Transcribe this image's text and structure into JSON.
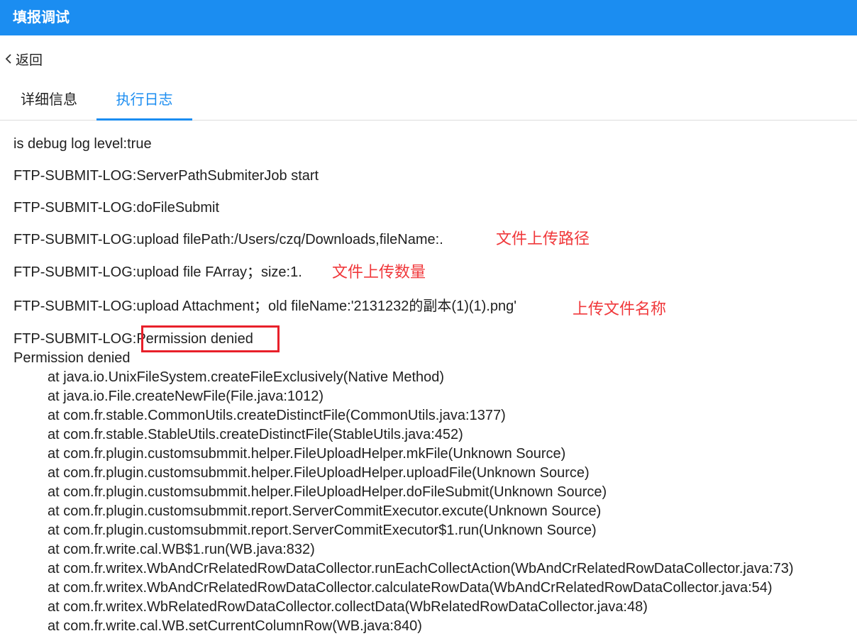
{
  "window": {
    "title": "填报调试"
  },
  "nav": {
    "back_label": "返回"
  },
  "tabs": [
    {
      "label": "详细信息",
      "active": false
    },
    {
      "label": "执行日志",
      "active": true
    }
  ],
  "log": {
    "lines": [
      "is debug log level:true",
      "FTP-SUBMIT-LOG:ServerPathSubmiterJob start",
      "FTP-SUBMIT-LOG:doFileSubmit",
      "FTP-SUBMIT-LOG:upload filePath:/Users/czq/Downloads,fileName:.",
      "FTP-SUBMIT-LOG:upload file FArray；size:1.",
      "FTP-SUBMIT-LOG:upload Attachment；old fileName:'2131232的副本(1)(1).png'",
      "FTP-SUBMIT-LOG:Permission denied"
    ],
    "error_message": "Permission denied",
    "stack_trace": [
      "at java.io.UnixFileSystem.createFileExclusively(Native Method)",
      "at java.io.File.createNewFile(File.java:1012)",
      "at com.fr.stable.CommonUtils.createDistinctFile(CommonUtils.java:1377)",
      "at com.fr.stable.StableUtils.createDistinctFile(StableUtils.java:452)",
      "at com.fr.plugin.customsubmmit.helper.FileUploadHelper.mkFile(Unknown Source)",
      "at com.fr.plugin.customsubmmit.helper.FileUploadHelper.uploadFile(Unknown Source)",
      "at com.fr.plugin.customsubmmit.helper.FileUploadHelper.doFileSubmit(Unknown Source)",
      "at com.fr.plugin.customsubmmit.report.ServerCommitExecutor.excute(Unknown Source)",
      "at com.fr.plugin.customsubmmit.report.ServerCommitExecutor$1.run(Unknown Source)",
      "at com.fr.write.cal.WB$1.run(WB.java:832)",
      "at com.fr.writex.WbAndCrRelatedRowDataCollector.runEachCollectAction(WbAndCrRelatedRowDataCollector.java:73)",
      "at com.fr.writex.WbAndCrRelatedRowDataCollector.calculateRowData(WbAndCrRelatedRowDataCollector.java:54)",
      "at com.fr.writex.WbRelatedRowDataCollector.collectData(WbRelatedRowDataCollector.java:48)",
      "at com.fr.write.cal.WB.setCurrentColumnRow(WB.java:840)"
    ]
  },
  "annotations": {
    "file_path": "文件上传路径",
    "file_count": "文件上传数量",
    "file_name": "上传文件名称"
  },
  "colors": {
    "title_bar": "#1b8df1",
    "active_tab": "#1b8df1",
    "annotation": "#f0383b",
    "highlight_box": "#e8202a"
  }
}
